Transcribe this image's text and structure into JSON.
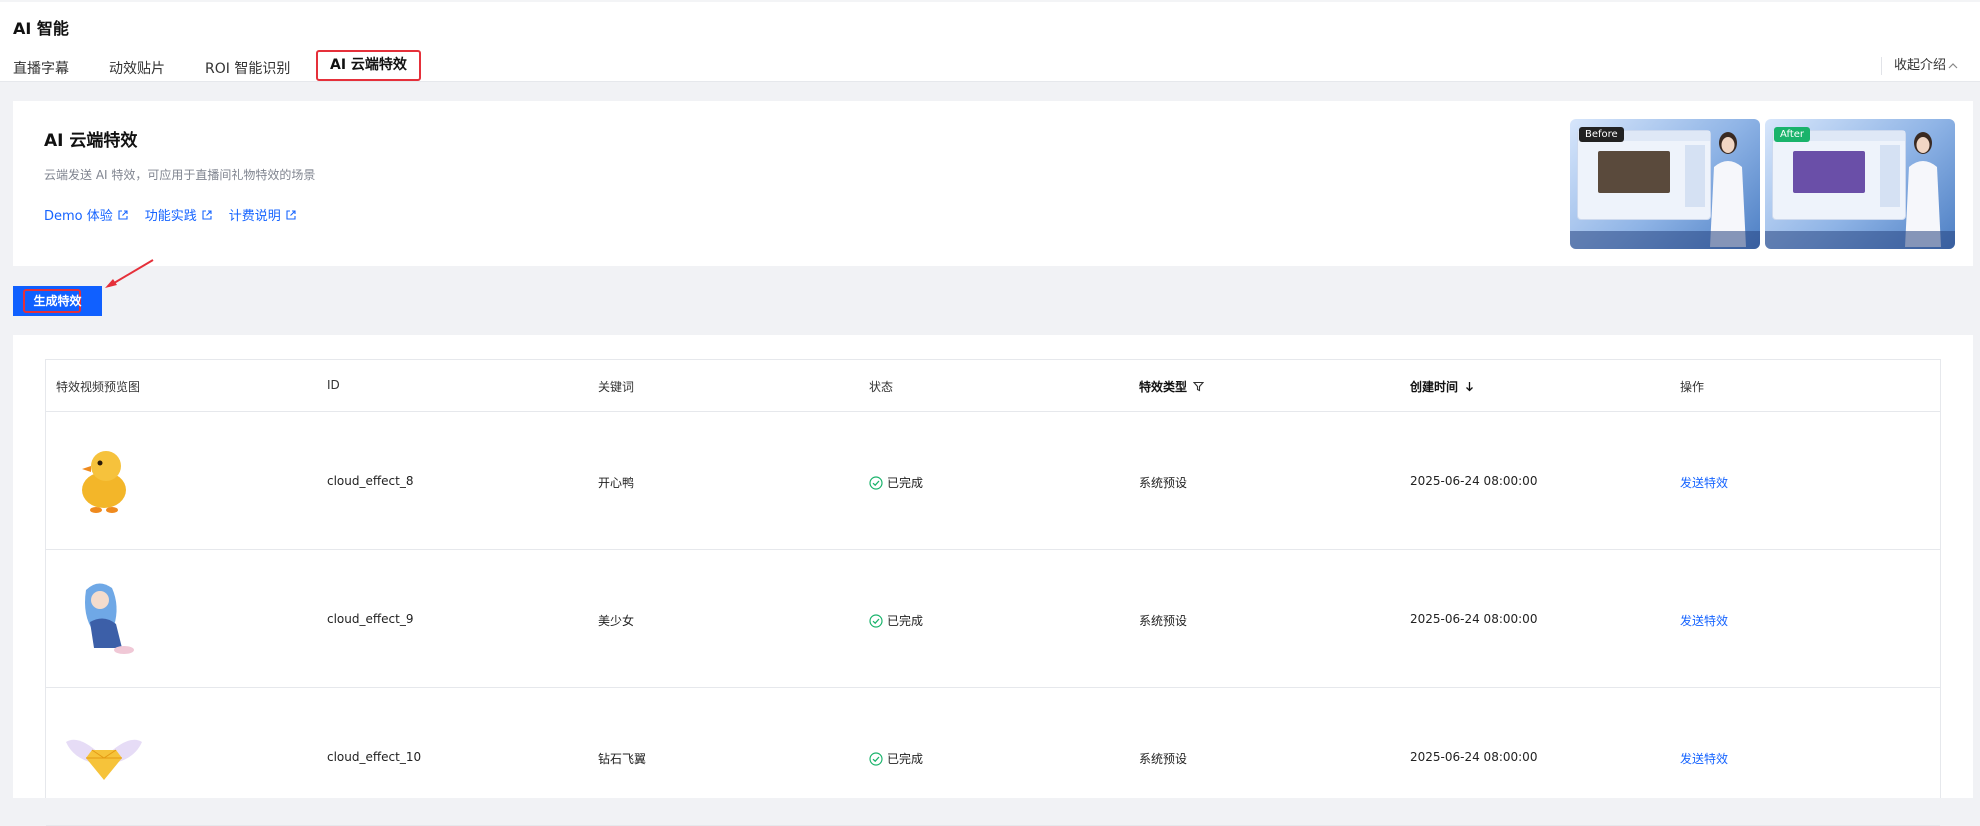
{
  "header": {
    "title": "AI 智能",
    "tabs": [
      {
        "label": "直播字幕"
      },
      {
        "label": "动效贴片"
      },
      {
        "label": "ROI 智能识别"
      },
      {
        "label": "AI 云端特效"
      }
    ],
    "active_tab": "AI 云端特效",
    "collapse_label": "收起介绍"
  },
  "intro": {
    "title": "AI 云端特效",
    "description": "云端发送 AI 特效，可应用于直播间礼物特效的场景",
    "links": [
      {
        "label": "Demo 体验"
      },
      {
        "label": "功能实践"
      },
      {
        "label": "计费说明"
      }
    ],
    "previews": [
      {
        "badge": "Before",
        "badge_color": "#222222"
      },
      {
        "badge": "After",
        "badge_color": "#19b36b"
      }
    ]
  },
  "actions": {
    "generate_label": "生成特效"
  },
  "table": {
    "columns": [
      "特效视频预览图",
      "ID",
      "关键词",
      "状态",
      "特效类型",
      "创建时间",
      "操作"
    ],
    "rows": [
      {
        "id": "cloud_effect_8",
        "keyword": "开心鸭",
        "status": "已完成",
        "type": "系统预设",
        "created": "2025-06-24 08:00:00",
        "action": "发送特效",
        "thumb": "duck"
      },
      {
        "id": "cloud_effect_9",
        "keyword": "美少女",
        "status": "已完成",
        "type": "系统预设",
        "created": "2025-06-24 08:00:00",
        "action": "发送特效",
        "thumb": "girl"
      },
      {
        "id": "cloud_effect_10",
        "keyword": "钻石飞翼",
        "status": "已完成",
        "type": "系统预设",
        "created": "2025-06-24 08:00:00",
        "action": "发送特效",
        "thumb": "diamond-wings"
      }
    ]
  },
  "colors": {
    "accent": "#1664ff",
    "primary_button": "#1060ff",
    "highlight_red": "#e5303a",
    "success": "#19b36b"
  }
}
